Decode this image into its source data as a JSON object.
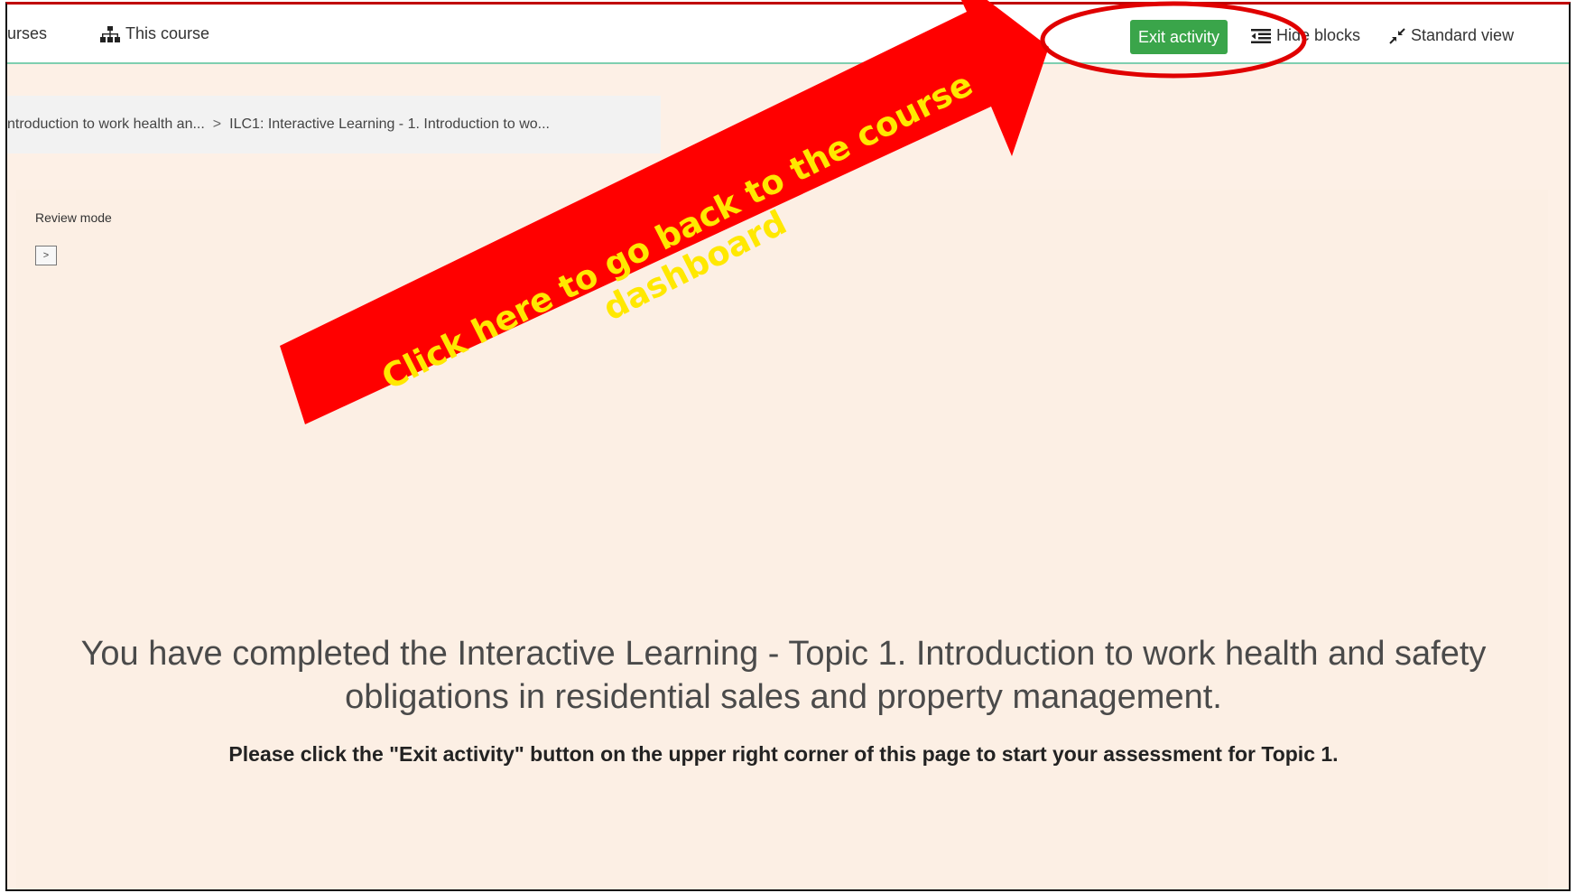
{
  "navbar": {
    "courses_label": "urses",
    "this_course_label": "This course",
    "exit_activity_label": "Exit activity",
    "hide_blocks_label": "Hide blocks",
    "standard_view_label": "Standard view"
  },
  "breadcrumb": {
    "item1": "ntroduction to work health an...",
    "separator": ">",
    "item2": "ILC1: Interactive Learning - 1. Introduction to wo..."
  },
  "content": {
    "review_mode_label": "Review mode",
    "toggle_label": ">",
    "completion_message": "You have completed the Interactive Learning - Topic 1. Introduction to work health and safety obligations in residential sales and property management.",
    "instruction": "Please click the \"Exit activity\" button on the upper right corner of this page to start your assessment for Topic 1."
  },
  "annotation": {
    "arrow_text": "Click here to go back to the course dashboard",
    "arrow_color": "#ff0000",
    "arrow_text_color": "#ffe800",
    "circle_color": "#e00000"
  },
  "colors": {
    "page_background": "#fdf0e6",
    "exit_button": "#3aa54a",
    "navbar_border": "#7fcfb0"
  }
}
